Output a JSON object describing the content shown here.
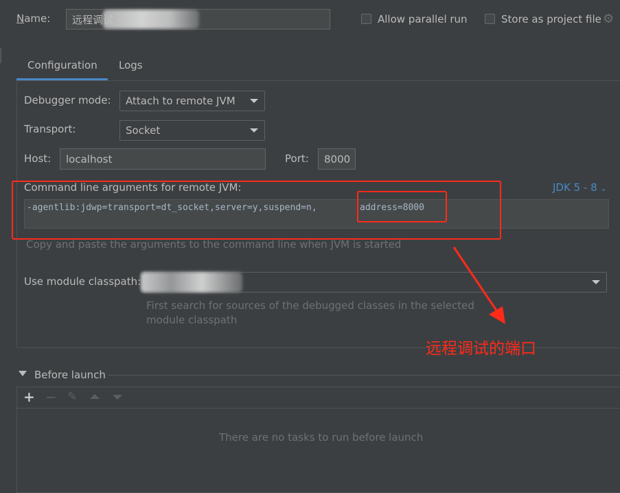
{
  "header": {
    "name_label": "Name:",
    "name_value": "远程调试",
    "allow_parallel_label": "Allow parallel run",
    "store_label": "Store as project file"
  },
  "tabs": [
    {
      "label": "Configuration",
      "active": true
    },
    {
      "label": "Logs",
      "active": false
    }
  ],
  "config": {
    "debugger_mode_label": "Debugger mode:",
    "debugger_mode_value": "Attach to remote JVM",
    "transport_label": "Transport:",
    "transport_value": "Socket",
    "host_label": "Host:",
    "host_value": "localhost",
    "port_label": "Port:",
    "port_value": "8000",
    "cmd_label": "Command line arguments for remote JVM:",
    "jdk_label": "JDK 5 - 8",
    "cmd_prefix": "-agentlib:jdwp=transport=dt_socket,server=y,suspend=n,",
    "cmd_address": "address=8000",
    "cmd_hint": "Copy and paste the arguments to the command line when JVM is started",
    "module_label": "Use module classpath:",
    "module_hint_line1": "First search for sources of the debugged classes in the selected",
    "module_hint_line2": "module classpath"
  },
  "annotation": {
    "text": "远程调试的端口",
    "color": "#ff2a1a"
  },
  "before_launch": {
    "title": "Before launch",
    "empty_text": "There are no tasks to run before launch",
    "toolbar": [
      "add-icon",
      "remove-icon",
      "edit-icon",
      "move-up-icon",
      "move-down-icon"
    ]
  },
  "colors": {
    "background": "#3c3f41",
    "accent": "#4a88c7",
    "annotation": "#ff2a1a"
  }
}
